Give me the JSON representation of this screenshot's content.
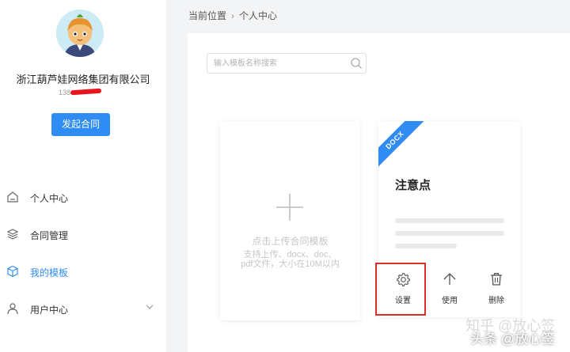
{
  "sidebar": {
    "company": "浙江葫芦娃网络集团有限公司",
    "phone": "138",
    "start_button": "发起合同",
    "items": [
      {
        "label": "个人中心",
        "icon": "home-icon"
      },
      {
        "label": "合同管理",
        "icon": "layers-icon"
      },
      {
        "label": "我的模板",
        "icon": "cube-icon",
        "active": true
      },
      {
        "label": "用户中心",
        "icon": "user-icon"
      }
    ]
  },
  "breadcrumb": {
    "prefix": "当前位置",
    "current": "个人中心"
  },
  "search": {
    "placeholder": "输入模板名称搜索"
  },
  "upload_card": {
    "title": "点击上传合同模板",
    "desc": "支持上传、docx、doc、pdf文件，大小在10M以内"
  },
  "template_card": {
    "badge": "DOCX",
    "title": "注意点",
    "actions": {
      "settings": "设置",
      "use": "使用",
      "delete": "删除"
    }
  },
  "watermark": {
    "zhihu": "知乎 @放心签",
    "toutiao": "头条 @放心签"
  },
  "colors": {
    "accent": "#2f8cf3",
    "highlight": "#d93025"
  }
}
